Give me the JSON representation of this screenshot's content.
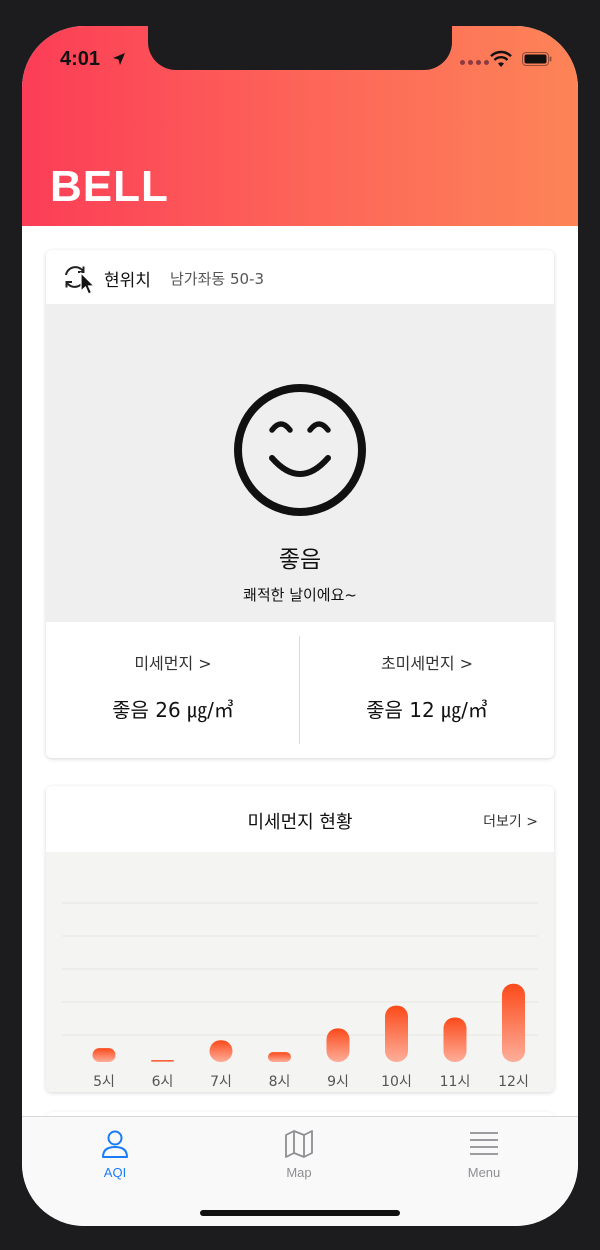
{
  "status_bar": {
    "time": "4:01"
  },
  "header": {
    "title": "BELL"
  },
  "location": {
    "label": "현위치",
    "address": "남가좌동 50-3"
  },
  "air_status": {
    "label": "좋음",
    "message": "쾌적한 날이에요~"
  },
  "metrics": [
    {
      "label": "미세먼지 >",
      "value": "좋음 26 ㎍/㎥"
    },
    {
      "label": "초미세먼지 >",
      "value": "좋음 12 ㎍/㎥"
    }
  ],
  "chart_section": {
    "title": "미세먼지 현황",
    "more_label": "더보기 >"
  },
  "chart_data": {
    "type": "bar",
    "categories": [
      "5시",
      "6시",
      "7시",
      "8시",
      "9시",
      "10시",
      "11시",
      "12시"
    ],
    "values": [
      14,
      2,
      22,
      10,
      34,
      57,
      45,
      79
    ],
    "ylim": [
      0,
      200
    ],
    "grid": true,
    "colors": {
      "top": "#fc4a1a",
      "bottom": "#fdae9a"
    }
  },
  "tabs": [
    {
      "label": "AQI",
      "icon": "person-icon",
      "active": true
    },
    {
      "label": "Map",
      "icon": "map-icon",
      "active": false
    },
    {
      "label": "Menu",
      "icon": "menu-icon",
      "active": false
    }
  ],
  "theme": {
    "header_start": "#fc3d57",
    "header_end": "#fd8457",
    "active_tab": "#1a7cf6"
  }
}
